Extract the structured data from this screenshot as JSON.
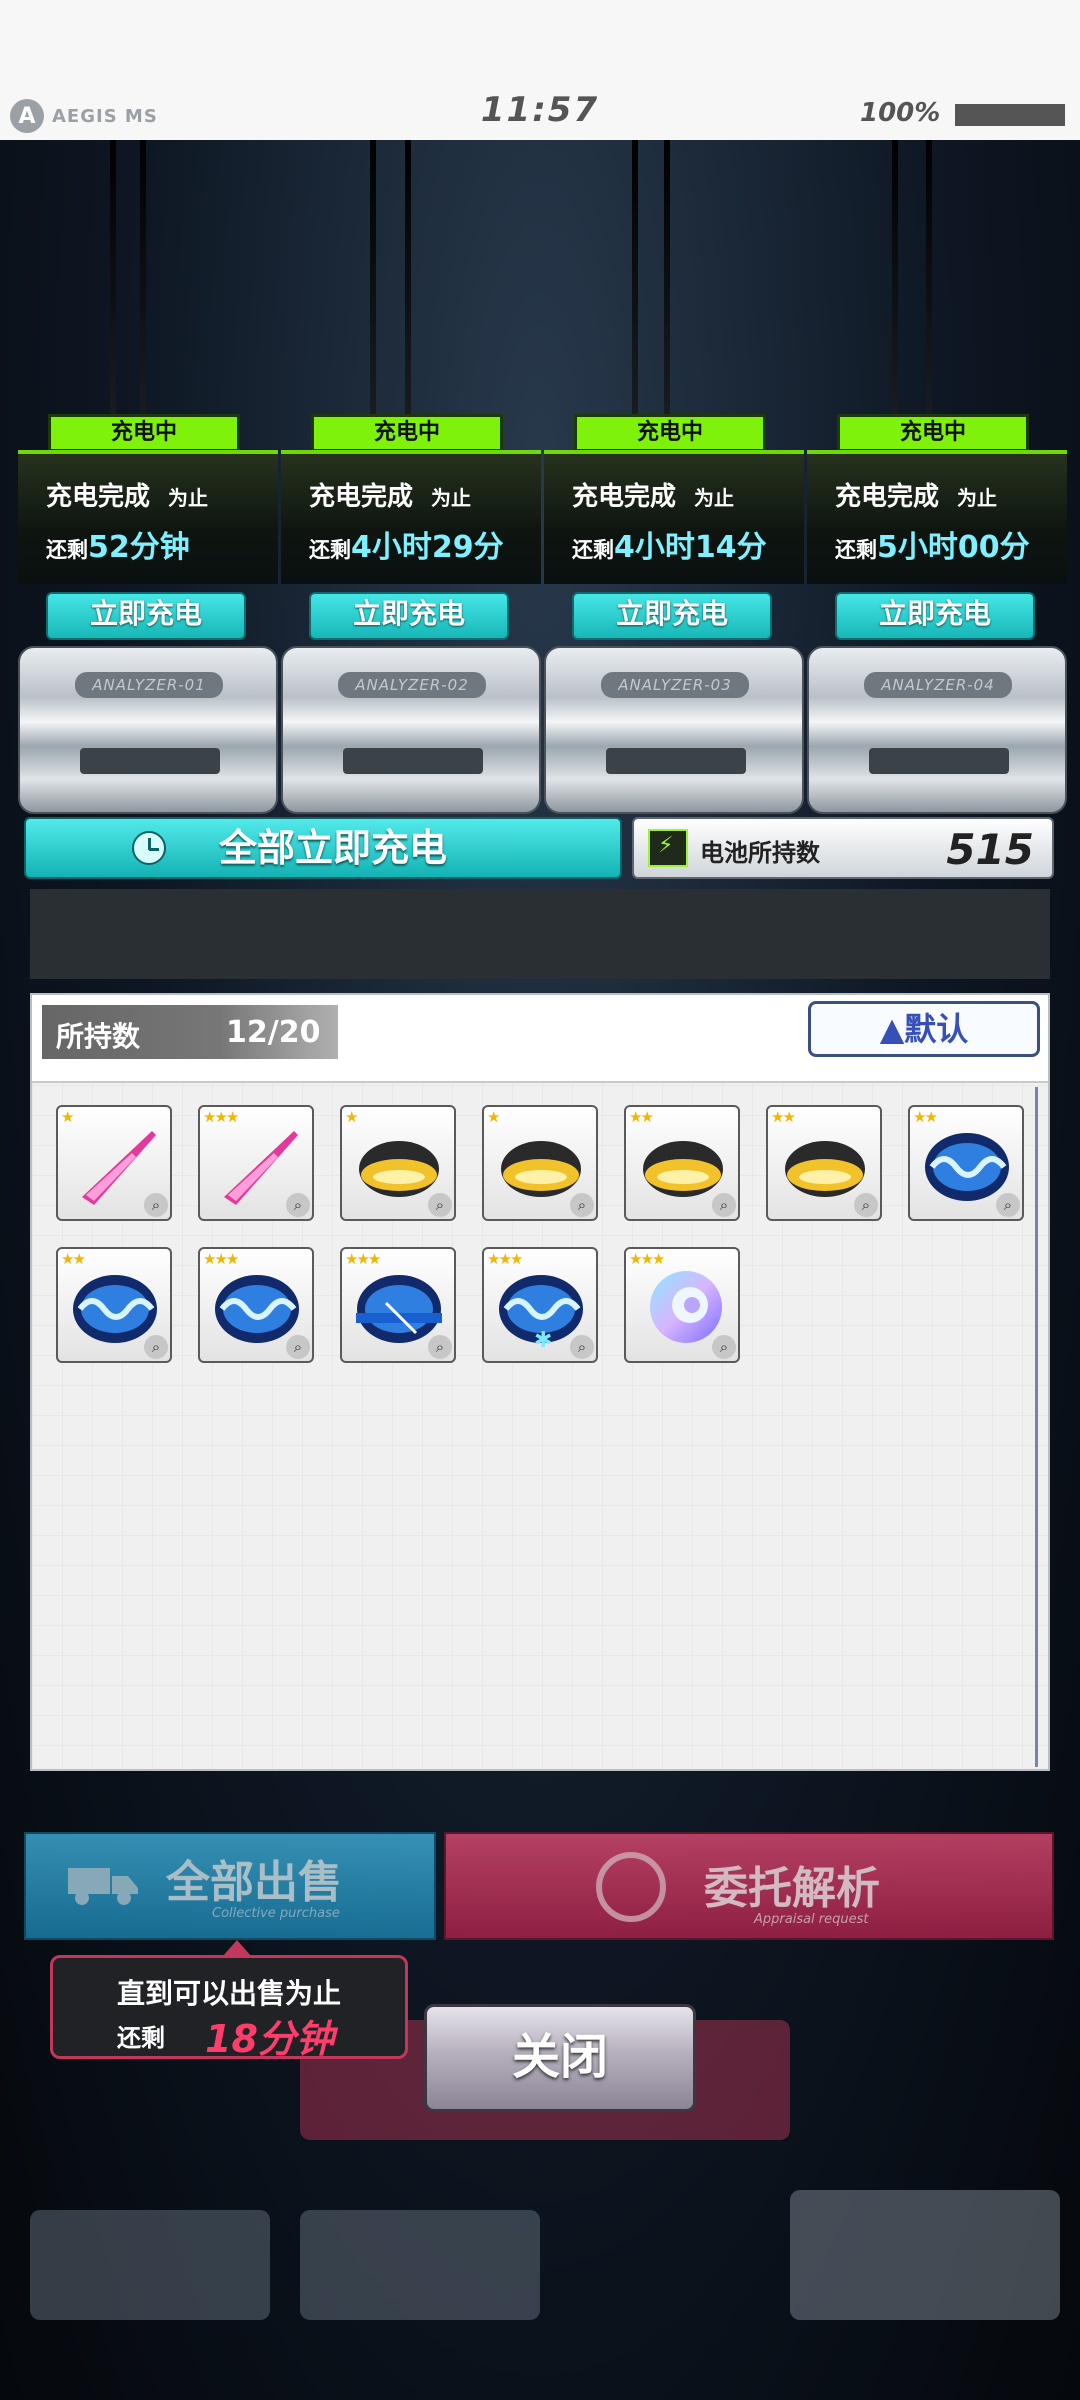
{
  "status_bar": {
    "brand": "AEGIS MS",
    "time": "11:57",
    "battery": "100%"
  },
  "chargers": [
    {
      "badge": "充电中",
      "line1": "充电完成",
      "line1_suffix": "为止",
      "remaining_label": "还剩",
      "remaining_time": "52分钟",
      "button": "立即充电",
      "analyzer": "ANALYZER-01"
    },
    {
      "badge": "充电中",
      "line1": "充电完成",
      "line1_suffix": "为止",
      "remaining_label": "还剩",
      "remaining_time": "4小时29分",
      "button": "立即充电",
      "analyzer": "ANALYZER-02"
    },
    {
      "badge": "充电中",
      "line1": "充电完成",
      "line1_suffix": "为止",
      "remaining_label": "还剩",
      "remaining_time": "4小时14分",
      "button": "立即充电",
      "analyzer": "ANALYZER-03"
    },
    {
      "badge": "充电中",
      "line1": "充电完成",
      "line1_suffix": "为止",
      "remaining_label": "还剩",
      "remaining_time": "5小时00分",
      "button": "立即充电",
      "analyzer": "ANALYZER-04"
    }
  ],
  "charge_all": {
    "label": "全部立即充电",
    "icon": "clock-icon"
  },
  "battery_holding": {
    "label": "电池所持数",
    "value": "515",
    "icon": "battery-icon"
  },
  "inventory": {
    "held_label": "所持数",
    "held_value": "12/20",
    "sort_button": "▲默认",
    "items": [
      {
        "stars": "★",
        "kind": "pink-spike",
        "icon": "pink-spike-icon"
      },
      {
        "stars": "★★★",
        "kind": "pink-spike",
        "icon": "pink-spike-icon"
      },
      {
        "stars": "★",
        "kind": "gold-shell",
        "icon": "gold-shell-icon"
      },
      {
        "stars": "★",
        "kind": "gold-shell",
        "icon": "gold-shell-icon"
      },
      {
        "stars": "★★",
        "kind": "gold-shell",
        "icon": "gold-shell-icon"
      },
      {
        "stars": "★★",
        "kind": "gold-shell",
        "icon": "gold-shell-icon"
      },
      {
        "stars": "★★",
        "kind": "blue-clam",
        "icon": "blue-clam-icon"
      },
      {
        "stars": "★★",
        "kind": "blue-clam",
        "icon": "blue-clam-icon"
      },
      {
        "stars": "★★★",
        "kind": "blue-clam",
        "icon": "blue-clam-icon"
      },
      {
        "stars": "★★★",
        "kind": "blue-clam-sword",
        "icon": "blue-clam-sword-icon"
      },
      {
        "stars": "★★★",
        "kind": "blue-clam-spark",
        "icon": "blue-clam-spark-icon"
      },
      {
        "stars": "★★★",
        "kind": "rainbow-nautilus",
        "icon": "nautilus-shell-icon"
      }
    ]
  },
  "sell_all": {
    "label": "全部出售",
    "sub": "Collective purchase",
    "icon": "truck-icon"
  },
  "appraise": {
    "label": "委托解析",
    "sub": "Appraisal request",
    "icon": "appraisal-ring-icon"
  },
  "tooltip": {
    "line1": "直到可以出售为止",
    "remaining_label": "还剩",
    "remaining_value": "18分钟"
  },
  "close_button": "关闭",
  "colors": {
    "charging_green": "#7ef20a",
    "teal_button": "#17b7b7",
    "time_cyan": "#7ff0ff",
    "alert_pink": "#ff3d6b"
  }
}
